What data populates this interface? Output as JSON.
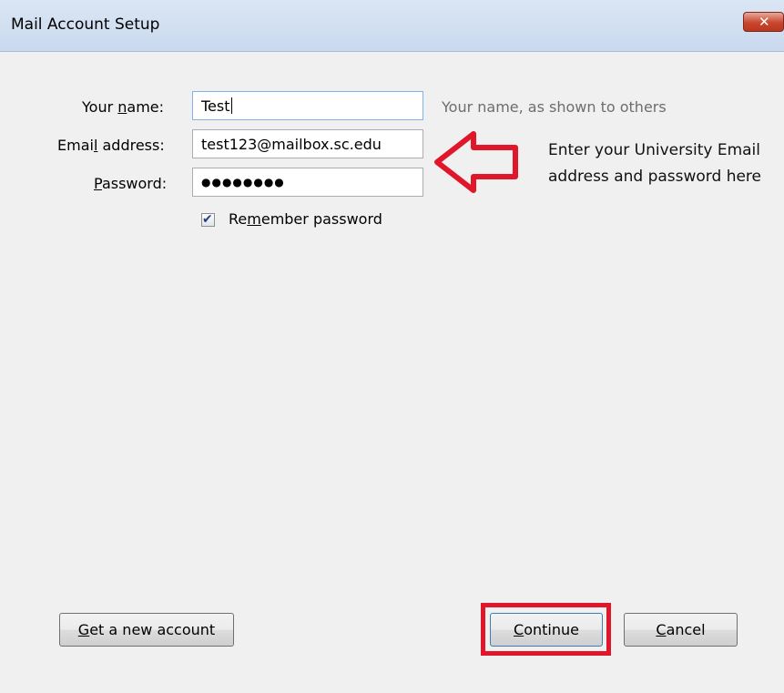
{
  "window": {
    "title": "Mail Account Setup",
    "close_glyph": "✕"
  },
  "form": {
    "name_label_pre": "Your ",
    "name_label_ul": "n",
    "name_label_post": "ame:",
    "name_value": "Test",
    "name_hint": "Your name, as shown to others",
    "email_label_pre": "Emai",
    "email_label_ul": "l",
    "email_label_post": " address:",
    "email_value": "test123@mailbox.sc.edu",
    "password_label_ul": "P",
    "password_label_post": "assword:",
    "password_value": "●●●●●●●●",
    "remember_checked": true,
    "remember_label_pre": "Re",
    "remember_label_ul": "m",
    "remember_label_post": "ember password"
  },
  "annotation": {
    "text": "Enter your University Email address and password here",
    "arrow_icon": "left-arrow-outline-icon",
    "color": "#e0172b"
  },
  "buttons": {
    "get_account_ul": "G",
    "get_account_post": "et a new account",
    "continue_ul": "C",
    "continue_post": "ontinue",
    "cancel_pre": "",
    "cancel_ul": "C",
    "cancel_post": "ancel"
  },
  "colors": {
    "dialog_bg": "#f0f0f0",
    "hint_text": "#6d6d6d",
    "highlight": "#e0172b",
    "close_button": "#c8462d"
  }
}
